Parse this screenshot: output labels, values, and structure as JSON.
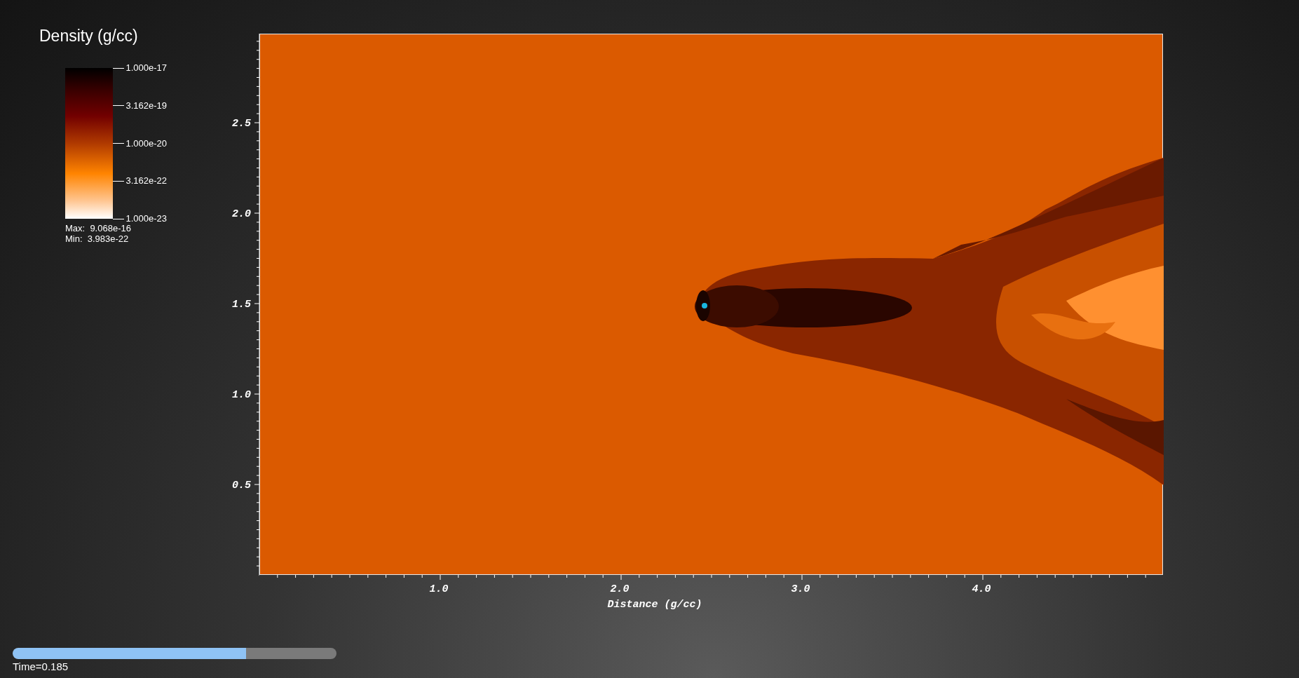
{
  "legend": {
    "title": "Density (g/cc)",
    "ticks": [
      "1.000e-17",
      "3.162e-19",
      "1.000e-20",
      "3.162e-22",
      "1.000e-23"
    ],
    "max_label": "Max:  9.068e-16",
    "min_label": "Min:  3.983e-22"
  },
  "plot": {
    "x_axis": {
      "title": "Distance (g/cc)",
      "ticks": [
        "1.0",
        "2.0",
        "3.0",
        "4.0"
      ]
    },
    "y_axis": {
      "ticks": [
        "2.5",
        "2.0",
        "1.5",
        "1.0",
        "0.5"
      ]
    }
  },
  "time_slider": {
    "level": 0.72,
    "label": "Time=0.185"
  }
}
